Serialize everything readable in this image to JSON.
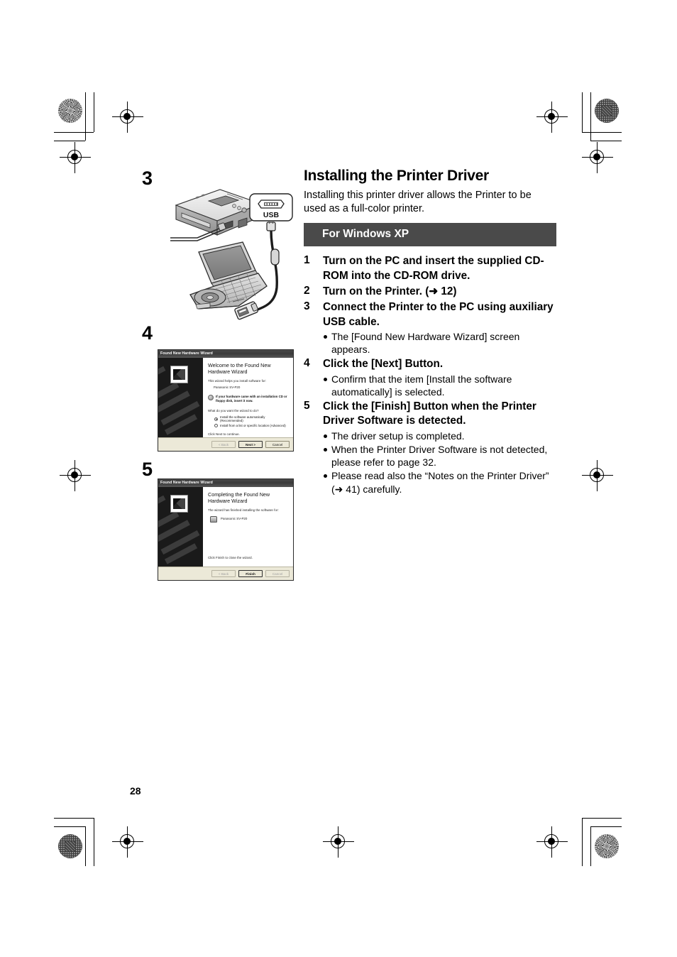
{
  "page": {
    "number": "28"
  },
  "margin_steps": {
    "step3": "3",
    "step4": "4",
    "step5": "5"
  },
  "section": {
    "title": "Installing the Printer Driver",
    "intro": "Installing this printer driver allows the Printer to be used as a full-color printer.",
    "os_banner": "For Windows XP"
  },
  "steps": [
    {
      "num": "1",
      "text": "Turn on the PC and insert the supplied CD-ROM into the CD-ROM drive.",
      "notes": []
    },
    {
      "num": "2",
      "text": "Turn on the Printer. (➜ 12)",
      "notes": []
    },
    {
      "num": "3",
      "text": "Connect the Printer to the PC using auxiliary USB cable.",
      "notes": [
        "The [Found New Hardware Wizard] screen appears."
      ]
    },
    {
      "num": "4",
      "text": "Click the [Next] Button.",
      "notes": [
        "Confirm that the item [Install the software automatically] is selected."
      ]
    },
    {
      "num": "5",
      "text": "Click the [Finish] Button when the Printer Driver Software is detected.",
      "notes": [
        "The driver setup is completed.",
        "When the Printer Driver Software is not detected, please refer to page 32.",
        "Please read also the “Notes on the Printer Driver” (➜ 41) carefully."
      ]
    }
  ],
  "illustration": {
    "usb_label": "USB",
    "usb_connector_icon": "usb-mini-connector-icon",
    "printer_icon": "portable-photo-printer-icon",
    "laptop_icon": "laptop-computer-icon",
    "cable_icon": "usb-cable-icon"
  },
  "dialogs": [
    {
      "id": "welcome",
      "titlebar": "Found New Hardware Wizard",
      "heading": "Welcome to the Found New Hardware Wizard",
      "line1": "This wizard helps you install software for:",
      "device": "Panasonic SV-P20",
      "warning": "If your hardware came with an installation CD or floppy disk, insert it now.",
      "question": "What do you want the wizard to do?",
      "options": [
        "Install the software automatically (Recommended)",
        "Install from a list or specific location (Advanced)"
      ],
      "selected_option": 0,
      "continue_hint": "Click Next to continue.",
      "buttons": [
        {
          "label": "< Back",
          "state": "disabled"
        },
        {
          "label": "Next >",
          "state": "default"
        },
        {
          "label": "Cancel",
          "state": "normal"
        }
      ]
    },
    {
      "id": "completing",
      "titlebar": "Found New Hardware Wizard",
      "heading": "Completing the Found New Hardware Wizard",
      "line1": "The wizard has finished installing the software for:",
      "device": "Panasonic SV-P20",
      "continue_hint": "Click Finish to close the wizard.",
      "buttons": [
        {
          "label": "< Back",
          "state": "disabled"
        },
        {
          "label": "Finish",
          "state": "default"
        },
        {
          "label": "Cancel",
          "state": "disabled"
        }
      ]
    }
  ],
  "colors": {
    "banner_bg": "#4a4a4a",
    "banner_text": "#ffffff",
    "text": "#000000",
    "page_bg": "#ffffff",
    "dialog_face": "#ece9d8"
  },
  "print_marks": {
    "corner_swatches": [
      "starburst",
      "maze",
      "maze",
      "starburst"
    ],
    "registration_targets": 8
  }
}
